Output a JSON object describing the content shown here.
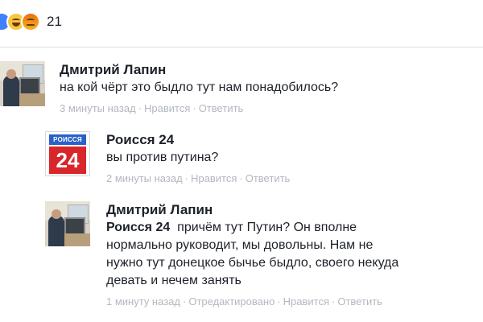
{
  "post": {
    "reaction_count": "21",
    "reaction_icons": [
      "like-icon",
      "haha-icon",
      "angry-icon"
    ]
  },
  "comments": [
    {
      "author": "Дмитрий Лапин",
      "text": "на кой чёрт это быдло тут нам понадобилось?",
      "time": "3 минуты назад",
      "like": "Нравится",
      "reply": "Ответить"
    },
    {
      "author": "Роисся 24",
      "avatar_bar_text": "РОИССЯ",
      "avatar_number": "24",
      "text": "вы против путина?",
      "time": "2 минуты назад",
      "like": "Нравится",
      "reply": "Ответить"
    },
    {
      "author": "Дмитрий Лапин",
      "mention": "Роисся 24",
      "text_lines": [
        "причём тут Путин? Он вполне",
        "нормально руководит, мы довольны. Нам не",
        "нужно тут донецкое бычье быдло, своего некуда",
        "девать и нечем занять"
      ],
      "time": "1 минуту назад",
      "edited": "Отредактировано",
      "like": "Нравится",
      "reply": "Ответить"
    }
  ],
  "colors": {
    "meta_text": "#b3b8bf",
    "logo_blue": "#2a61c8",
    "logo_red": "#d9262b"
  }
}
